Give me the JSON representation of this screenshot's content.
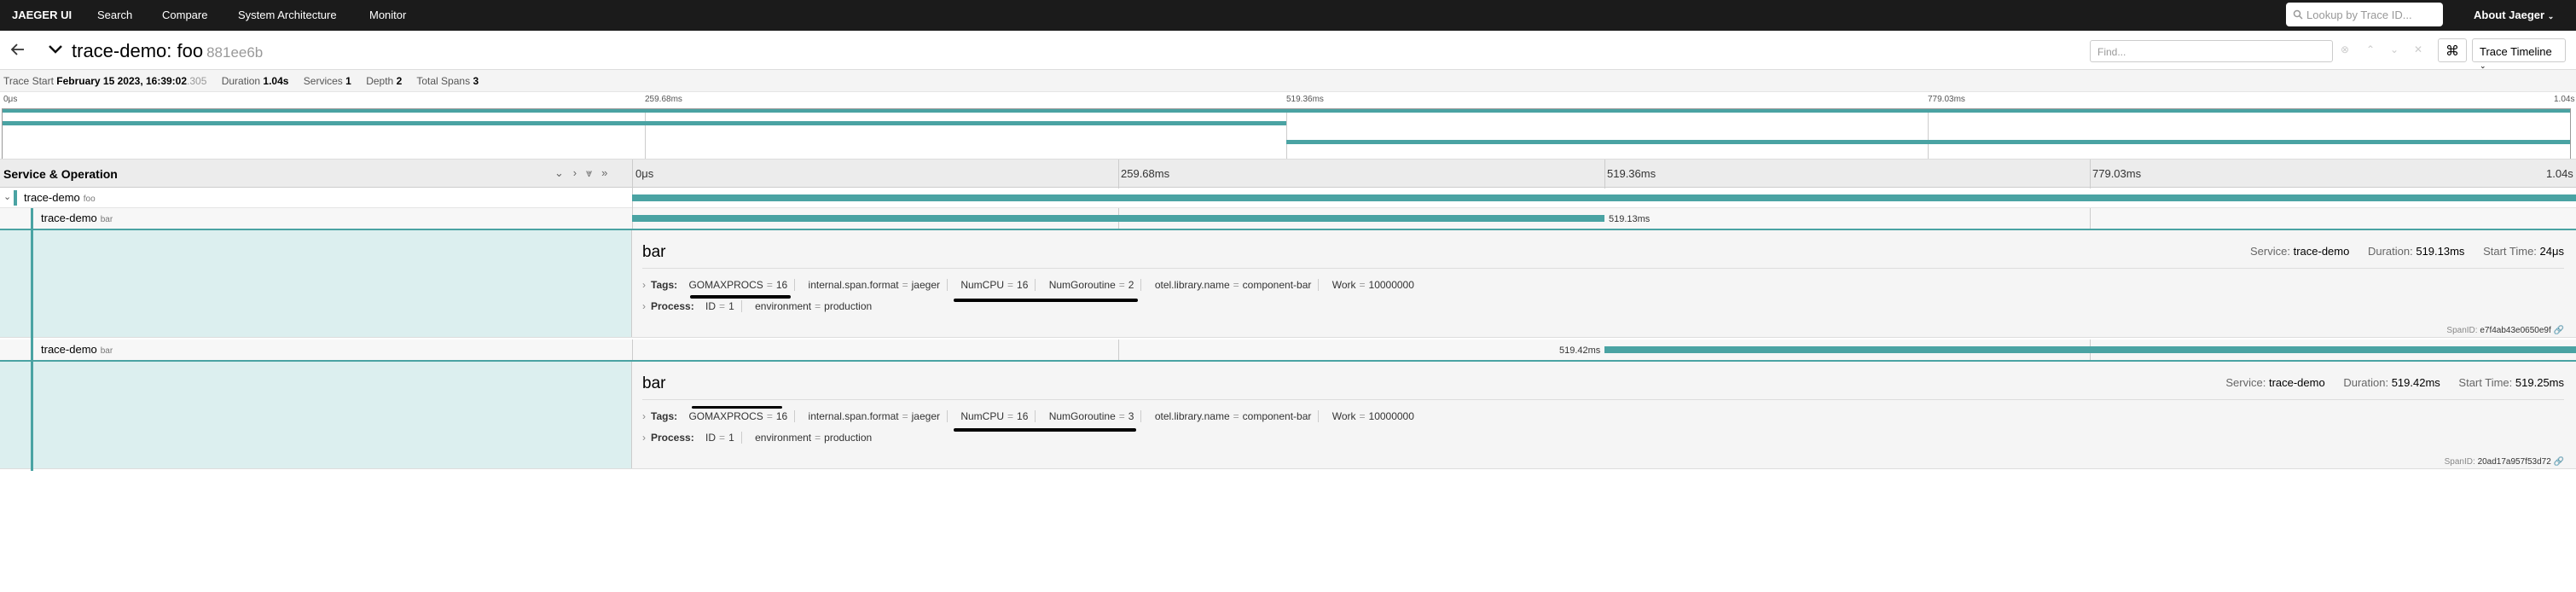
{
  "nav": {
    "brand": "JAEGER UI",
    "items": [
      "Search",
      "Compare",
      "System Architecture",
      "Monitor"
    ],
    "lookup_placeholder": "Lookup by Trace ID...",
    "about": "About Jaeger"
  },
  "header": {
    "title": "trace-demo: foo",
    "trace_id": "881ee6b",
    "find_placeholder": "Find...",
    "kbd": "⌘",
    "view_label": "Trace Timeline"
  },
  "meta": {
    "trace_start_label": "Trace Start",
    "trace_start_value": "February 15 2023, 16:39:02",
    "trace_start_ms": ".305",
    "duration_label": "Duration",
    "duration_value": "1.04s",
    "services_label": "Services",
    "services_value": "1",
    "depth_label": "Depth",
    "depth_value": "2",
    "total_spans_label": "Total Spans",
    "total_spans_value": "3"
  },
  "ticks": [
    "0μs",
    "259.68ms",
    "519.36ms",
    "779.03ms",
    "1.04s"
  ],
  "table": {
    "service_operation_label": "Service & Operation"
  },
  "spans": [
    {
      "service": "trace-demo",
      "operation": "foo"
    },
    {
      "service": "trace-demo",
      "operation": "bar",
      "duration_label": "519.13ms"
    },
    {
      "service": "trace-demo",
      "operation": "bar",
      "duration_label": "519.42ms"
    }
  ],
  "details": [
    {
      "name": "bar",
      "service_label": "Service:",
      "service": "trace-demo",
      "duration_label": "Duration:",
      "duration": "519.13ms",
      "start_label": "Start Time:",
      "start": "24μs",
      "tags_label": "Tags:",
      "tags": [
        {
          "k": "GOMAXPROCS",
          "v": "16"
        },
        {
          "k": "internal.span.format",
          "v": "jaeger"
        },
        {
          "k": "NumCPU",
          "v": "16"
        },
        {
          "k": "NumGoroutine",
          "v": "2"
        },
        {
          "k": "otel.library.name",
          "v": "component-bar"
        },
        {
          "k": "Work",
          "v": "10000000"
        }
      ],
      "process_label": "Process:",
      "process": [
        {
          "k": "ID",
          "v": "1"
        },
        {
          "k": "environment",
          "v": "production"
        }
      ],
      "spanid_label": "SpanID:",
      "spanid": "e7f4ab43e0650e9f"
    },
    {
      "name": "bar",
      "service_label": "Service:",
      "service": "trace-demo",
      "duration_label": "Duration:",
      "duration": "519.42ms",
      "start_label": "Start Time:",
      "start": "519.25ms",
      "tags_label": "Tags:",
      "tags": [
        {
          "k": "GOMAXPROCS",
          "v": "16"
        },
        {
          "k": "internal.span.format",
          "v": "jaeger"
        },
        {
          "k": "NumCPU",
          "v": "16"
        },
        {
          "k": "NumGoroutine",
          "v": "3"
        },
        {
          "k": "otel.library.name",
          "v": "component-bar"
        },
        {
          "k": "Work",
          "v": "10000000"
        }
      ],
      "process_label": "Process:",
      "process": [
        {
          "k": "ID",
          "v": "1"
        },
        {
          "k": "environment",
          "v": "production"
        }
      ],
      "spanid_label": "SpanID:",
      "spanid": "20ad17a957f53d72"
    }
  ],
  "colors": {
    "span": "#4aa3a3",
    "nav": "#1b1b1b"
  }
}
